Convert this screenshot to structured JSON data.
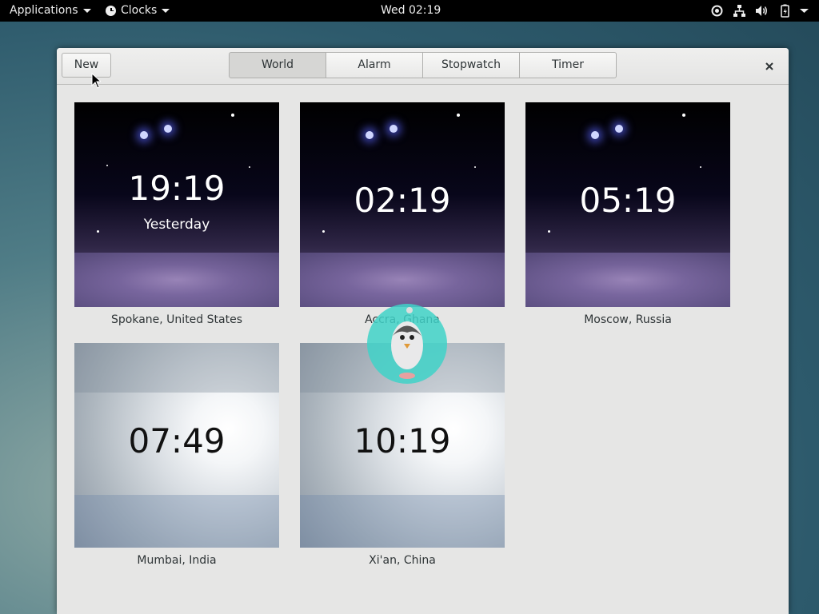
{
  "topbar": {
    "applications": "Applications",
    "app_name": "Clocks",
    "datetime": "Wed 02:19"
  },
  "header": {
    "new_label": "New",
    "tabs": [
      {
        "label": "World",
        "active": true
      },
      {
        "label": "Alarm"
      },
      {
        "label": "Stopwatch"
      },
      {
        "label": "Timer"
      }
    ]
  },
  "clocks": [
    {
      "time": "19:19",
      "day": "Yesterday",
      "city": "Spokane, United States",
      "theme": "night"
    },
    {
      "time": "02:19",
      "day": "",
      "city": "Accra, Ghana",
      "theme": "night"
    },
    {
      "time": "05:19",
      "day": "",
      "city": "Moscow, Russia",
      "theme": "night"
    },
    {
      "time": "07:49",
      "day": "",
      "city": "Mumbai, India",
      "theme": "day"
    },
    {
      "time": "10:19",
      "day": "",
      "city": "Xi'an, China",
      "theme": "day"
    }
  ],
  "icons": {
    "clock": "clock-icon",
    "location": "location-icon",
    "network": "network-icon",
    "volume": "volume-icon",
    "battery": "battery-icon",
    "close": "close-icon"
  }
}
